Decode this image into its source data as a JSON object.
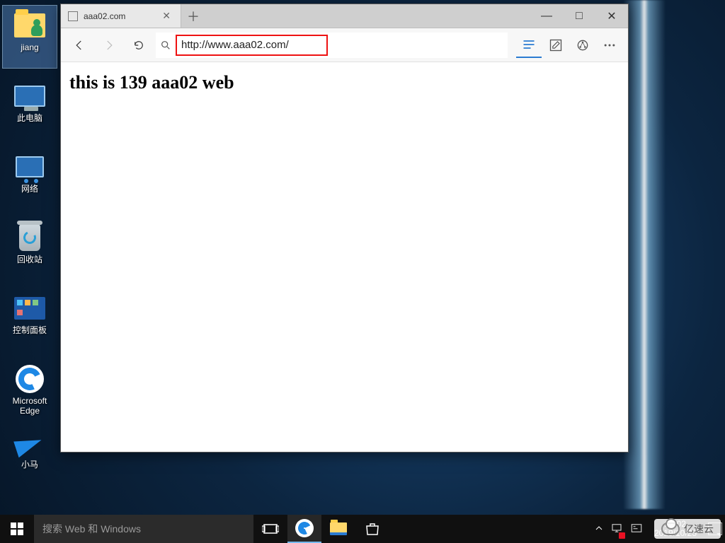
{
  "desktop": {
    "icons": [
      {
        "id": "user-folder",
        "label": "jiang",
        "selected": true
      },
      {
        "id": "this-pc",
        "label": "此电脑",
        "selected": false
      },
      {
        "id": "network",
        "label": "网络",
        "selected": false
      },
      {
        "id": "recycle-bin",
        "label": "回收站",
        "selected": false
      },
      {
        "id": "control-panel",
        "label": "控制面板",
        "selected": false
      },
      {
        "id": "edge",
        "label": "Microsoft\nEdge",
        "selected": false
      },
      {
        "id": "xiaoma",
        "label": "小马",
        "selected": false
      }
    ]
  },
  "browser": {
    "tab_title": "aaa02.com",
    "address": "http://www.aaa02.com/",
    "page_heading": "this is 139 aaa02 web",
    "window_controls": {
      "minimize": "—",
      "maximize": "□",
      "close": "✕"
    },
    "nav": {
      "back_enabled": true,
      "forward_enabled": false
    }
  },
  "taskbar": {
    "search_placeholder": "搜索 Web 和 Windows",
    "clock_time": "22:02",
    "clock_date": "2019/10/23",
    "apps": [
      {
        "id": "task-view",
        "active": false
      },
      {
        "id": "edge",
        "active": true
      },
      {
        "id": "file-explorer",
        "active": false
      },
      {
        "id": "store",
        "active": false
      }
    ]
  },
  "watermark": {
    "text": "亿速云"
  }
}
